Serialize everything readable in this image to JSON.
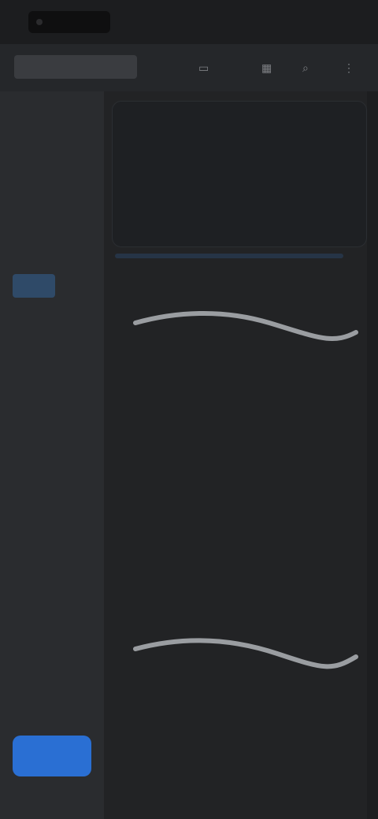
{
  "status": {
    "time": ""
  },
  "header": {
    "title": "",
    "icons": [
      "",
      "",
      "",
      ""
    ]
  },
  "sidebar": {
    "items": [
      "",
      "",
      "",
      "",
      "",
      "",
      "",
      "",
      "",
      "",
      "",
      "",
      ""
    ],
    "active_index": 4,
    "cta_label": ""
  },
  "main": {
    "hero": {
      "title": "",
      "action": ""
    },
    "sections": [
      "",
      "",
      "",
      ""
    ]
  },
  "colors": {
    "accent": "#2a6fd3",
    "active_nav": "#2f4a68",
    "background": "#1f2022"
  }
}
